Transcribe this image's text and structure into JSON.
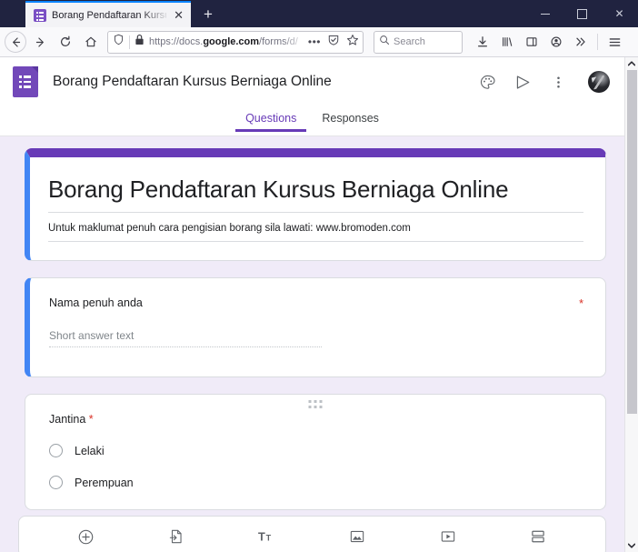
{
  "browser": {
    "tab": {
      "title": "Borang Pendaftaran Kursus Ber",
      "close_label": "✕",
      "favicon_name": "google-forms-favicon"
    },
    "newtab_label": "+",
    "window_controls": {
      "minimize": "–",
      "maximize": "□",
      "close": "✕"
    },
    "url": {
      "prefix": "https://docs.",
      "domain": "google.com",
      "suffix": "/forms/d/"
    },
    "url_menu_label": "•••",
    "search": {
      "placeholder": "Search"
    }
  },
  "forms": {
    "app_title": "Borang Pendaftaran Kursus Berniaga Online",
    "tabs": [
      {
        "label": "Questions",
        "active": true
      },
      {
        "label": "Responses",
        "active": false
      }
    ],
    "header_icons": [
      "palette-icon",
      "send-icon",
      "more-vert-icon",
      "avatar"
    ],
    "title_card": {
      "heading": "Borang Pendaftaran Kursus Berniaga Online",
      "description": "Untuk maklumat penuh cara pengisian borang sila lawati: www.bromoden.com"
    },
    "questions": [
      {
        "label": "Nama penuh anda",
        "required": true,
        "required_marker": "*",
        "type": "short-answer",
        "answer_placeholder": "Short answer text"
      },
      {
        "label": "Jantina",
        "required": true,
        "required_marker": "*",
        "type": "multiple-choice",
        "options": [
          "Lelaki",
          "Perempuan"
        ]
      }
    ],
    "bottom_toolbar": [
      "add-question-icon",
      "import-questions-icon",
      "add-title-icon",
      "add-image-icon",
      "add-video-icon",
      "add-section-icon"
    ],
    "annotation": {
      "highlight_target": "Responses",
      "highlight_color": "#d32b21",
      "arrow_color": "#d32b21"
    },
    "colors": {
      "accent_purple": "#673ab7",
      "card_blue": "#4285f4",
      "page_background": "#f0ebf8",
      "required_red": "#d93025"
    }
  }
}
